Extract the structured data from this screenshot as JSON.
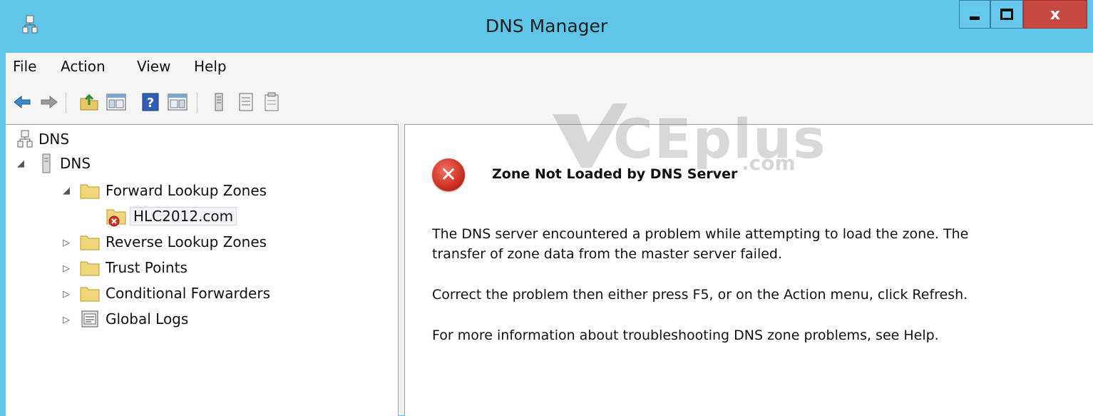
{
  "window": {
    "title": "DNS Manager",
    "minimize_icon": "minimize-icon",
    "maximize_icon": "maximize-icon",
    "close_icon": "close-icon",
    "close_glyph": "x"
  },
  "menu": {
    "items": [
      "File",
      "Action",
      "View",
      "Help"
    ]
  },
  "toolbar": {
    "icons": [
      "back-arrow-icon",
      "forward-arrow-icon",
      "up-folder-icon",
      "show-hide-console-tree-icon",
      "help-icon",
      "show-hide-action-pane-icon",
      "server-icon",
      "list-icon",
      "properties-icon"
    ]
  },
  "tree": {
    "root": "DNS",
    "server": "DNS",
    "forward_zones": "Forward Lookup Zones",
    "zone": "HLC2012.com",
    "reverse_zones": "Reverse Lookup Zones",
    "trust_points": "Trust Points",
    "conditional_forwarders": "Conditional Forwarders",
    "global_logs": "Global Logs"
  },
  "detail": {
    "title": "Zone Not Loaded by DNS Server",
    "line1": "The DNS server encountered a problem while attempting to load the zone. The",
    "line2": "transfer of zone data from the master server failed.",
    "line3": "Correct the problem then either press F5, or on the Action menu, click Refresh.",
    "line4": "For more information about troubleshooting DNS zone problems, see Help."
  },
  "watermark": {
    "text": "CEplus",
    "suffix": ".com"
  },
  "colors": {
    "titlebar": "#5fc6e9",
    "close_button": "#c64840",
    "error_red": "#c92b1f"
  }
}
